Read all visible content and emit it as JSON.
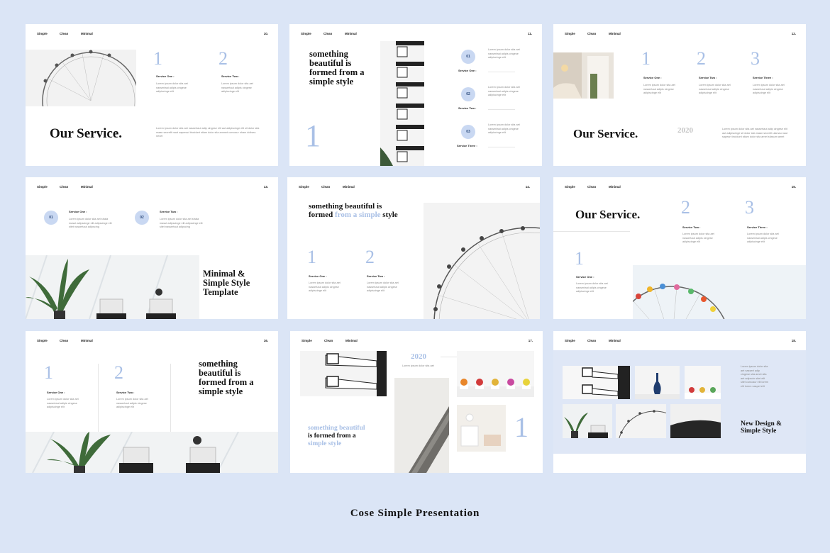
{
  "nav": {
    "simple": "Simple",
    "clean": "Clean",
    "minimal": "Minimal"
  },
  "slides": [
    {
      "page": "10.",
      "num1": "1",
      "num2": "2",
      "svc1": "Service One :",
      "svc2": "Service Two :",
      "lorem1": "Lorem ipsum dolor sita aet nassertaut adipis cingese adipiscinge elit",
      "lorem2": "Lorem ipsum dolor sita aet nassertaut adipis cingese adipiscinge elit",
      "heading": "Our Service.",
      "bottom_lorem": "Lorem ipsum dolor sita aet nassertaut adip cingese elit aut adipiscinge elit sit dolor sita maan secrelit naut sapenad tincidunt stiam dolor sita ammet curscaur nham dolisea nexet"
    },
    {
      "page": "11.",
      "heading": "something beautiful is formed from a simple style",
      "num": "1",
      "c1": "01",
      "c2": "02",
      "c3": "03",
      "svc1": "Service One :",
      "svc2": "Service Two :",
      "svc3": "Service Three :",
      "lorem1": "Lorem ipsum dolor sita aet nassertaut adipis cingese adipiscinge elit",
      "lorem2": "Lorem ipsum dolor sita aet nassertaut adipis cingese adipiscinge elit",
      "lorem3": "Lorem ipsum dolor sita aet nassertaut adipis cingese adipiscinge elit"
    },
    {
      "page": "12.",
      "num1": "1",
      "num2": "2",
      "num3": "3",
      "svc1": "Service One :",
      "svc2": "Service Two :",
      "svc3": "Service Three :",
      "lorem1": "Lorem ipsum dolor sita aet nassertaut adipis cingese adipiscinge elit",
      "lorem2": "Lorem ipsum dolor sita aet nassertaut adipis cingese adipiscinge elit",
      "lorem3": "Lorem ipsum dolor sita aet nassertaut adipis cingese adipiscinge elit",
      "heading": "Our Service.",
      "year": "2020",
      "bottom_lorem": "Lorem ipsum dolor sita aet nassertaut adip cingese elit aut adipiscinge sit dolor sita maan secrelit ulamau naut sapean tincidunt stiam dolor sita amet stiasum amet"
    },
    {
      "page": "13.",
      "c1": "01",
      "c2": "02",
      "svc1": "Service One :",
      "svc2": "Service Two :",
      "lorem1": "Lorem ipsum dolor sita aet strata masut adipscinge elit adipscinge elit sitet nassertaut adipscing",
      "lorem2": "Lorem ipsum dolor sita aet strata masut adipscinge elit adipscinge elit sitet nassertaut adipscing",
      "heading": "Minimal & Simple Style Template"
    },
    {
      "page": "14.",
      "heading_dark": "something beautiful is formed",
      "heading_light": "from a simple",
      "heading_end": "style",
      "num1": "1",
      "num2": "2",
      "svc1": "Service One :",
      "svc2": "Service Two :",
      "lorem1": "Lorem ipsum dolor sita aet nassertaut adipis cingese adipiscinge elit",
      "lorem2": "Lorem ipsum dolor sita aet nassertaut adipis cingese adipiscinge elit"
    },
    {
      "page": "15.",
      "heading": "Our Service.",
      "num1": "1",
      "num2": "2",
      "num3": "3",
      "svc1": "Service One :",
      "svc2": "Service Two :",
      "svc3": "Service Three :",
      "lorem1": "Lorem ipsum dolor sita aet nassertaut adipis cingese adipiscinge elit",
      "lorem2": "Lorem ipsum dolor sita aet nassertaut adipis cingese adipiscinge elit",
      "lorem3": "Lorem ipsum dolor sita aet nassertaut adipis cingese adipiscinge elit"
    },
    {
      "page": "16.",
      "num1": "1",
      "num2": "2",
      "svc1": "Service One :",
      "svc2": "Service Two :",
      "lorem1": "Lorem ipsum dolor sita aet nassertaut adipis cingese adipiscinge elit",
      "lorem2": "Lorem ipsum dolor sita aet nassertaut adipis cingese adipiscinge elit",
      "heading": "something beautiful is formed from a simple style"
    },
    {
      "page": "17.",
      "year": "2020",
      "year_lorem": "Lorem ipsum dolor sita aet",
      "light1": "something beautiful",
      "dark": "is formed from a",
      "light2": "simple style",
      "num": "1"
    },
    {
      "page": "18.",
      "lorem": "Lorem ipsum dolor sita aet nassert adip cingese sita amet sita aet adipscin sitet elit sitet curscaur elit lorem elit lorem naspet elit",
      "heading": "New Design & Simple Style"
    }
  ],
  "caption": "Cose Simple Presentation",
  "colors": {
    "background": "#dbe5f6",
    "accent": "#a9c0e6",
    "circle": "#c9d8f2",
    "slide": "#ffffff"
  }
}
